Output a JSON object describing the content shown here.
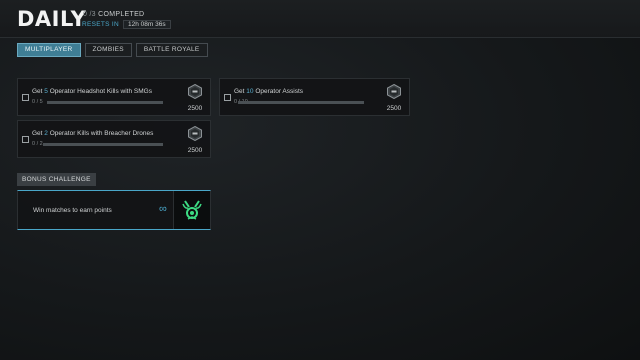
{
  "header": {
    "title": "DAILY",
    "completed_count": "0 /3",
    "completed_label": "COMPLETED",
    "resets_label": "RESETS IN",
    "timer": "12h 08m 36s"
  },
  "tabs": [
    {
      "label": "MULTIPLAYER",
      "active": true
    },
    {
      "label": "ZOMBIES",
      "active": false
    },
    {
      "label": "BATTLE ROYALE",
      "active": false
    }
  ],
  "challenges": [
    {
      "pre": "Get ",
      "num": "5",
      "post": " Operator Headshot Kills with SMGs",
      "progress_text": "0 / 5",
      "progress": 0,
      "reward": "2500",
      "reward_icon": "xp-token-icon"
    },
    {
      "pre": "Get ",
      "num": "10",
      "post": " Operator Assists",
      "progress_text": "0 / 10",
      "progress": 0,
      "reward": "2500",
      "reward_icon": "xp-token-icon"
    },
    {
      "pre": "Get ",
      "num": "2",
      "post": " Operator Kills with Breacher Drones",
      "progress_text": "0 / 2",
      "progress": 0,
      "reward": "2500",
      "reward_icon": "xp-token-icon"
    }
  ],
  "bonus": {
    "label": "BONUS CHALLENGE",
    "text": "Win matches to earn points",
    "symbol": "∞",
    "reward_icon": "medal-icon"
  },
  "colors": {
    "accent": "#4aa7c9",
    "tab_active": "#3f7e95",
    "bonus_icon": "#3ddc84"
  }
}
